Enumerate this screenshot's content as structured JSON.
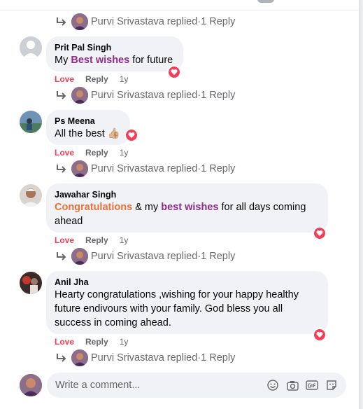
{
  "comments": [
    {
      "author": "Prit Pal Singh",
      "time": "1y",
      "love_label": "Love",
      "reply_label": "Reply",
      "text_parts": [
        "My ",
        "Best wishes",
        " for future"
      ]
    },
    {
      "author": "Ps Meena",
      "time": "1y",
      "love_label": "Love",
      "reply_label": "Reply",
      "text": "All the best",
      "emoji": "👍🏼"
    },
    {
      "author": "Jawahar Singh",
      "time": "1y",
      "love_label": "Love",
      "reply_label": "Reply",
      "text_parts": [
        "Congratulations",
        " & my ",
        "best wishes",
        " for all days coming",
        "ahead"
      ]
    },
    {
      "author": "Anil Jha",
      "time": "1y",
      "love_label": "Love",
      "reply_label": "Reply",
      "lines": [
        "Hearty congratulations ,wishing for your happy healthy",
        "future endivours with your family. God bless you all",
        "success in coming ahead."
      ]
    }
  ],
  "reply_summary": {
    "name": "Purvi Srivastava replied",
    "sep": " · ",
    "count": "1 Reply"
  },
  "composer": {
    "placeholder": "Write a comment..."
  },
  "icons": {
    "reply_arrow": "reply-arrow-icon",
    "reaction": "heart-icon",
    "composer": [
      "emoji-icon",
      "camera-icon",
      "gif-icon",
      "sticker-icon"
    ]
  },
  "colors": {
    "love": "#f33e58",
    "highlight_purple": "#8b2d8a",
    "highlight_orange": "#e8713c",
    "bubble": "#f0f2f5",
    "muted": "#65676b"
  }
}
